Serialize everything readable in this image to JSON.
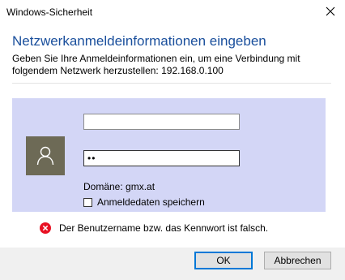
{
  "window": {
    "title": "Windows-Sicherheit"
  },
  "dialog": {
    "heading": "Netzwerkanmeldeinformationen eingeben",
    "description": "Geben Sie Ihre Anmeldeinformationen ein, um eine Verbindung mit folgendem Netzwerk herzustellen: 192.168.0.100"
  },
  "credentials": {
    "username_value": "",
    "password_value": "••",
    "domain_text": "Domäne: gmx.at",
    "remember_label": "Anmeldedaten speichern",
    "remember_checked": false,
    "avatar_icon": "user-icon",
    "panel_color": "#d3d6f6"
  },
  "error": {
    "icon": "error-icon",
    "message": "Der Benutzername bzw. das Kennwort ist falsch.",
    "color": "#e81123"
  },
  "buttons": {
    "ok_label": "OK",
    "cancel_label": "Abbrechen"
  },
  "colors": {
    "accent": "#0078d7",
    "heading": "#1a4f9c"
  }
}
